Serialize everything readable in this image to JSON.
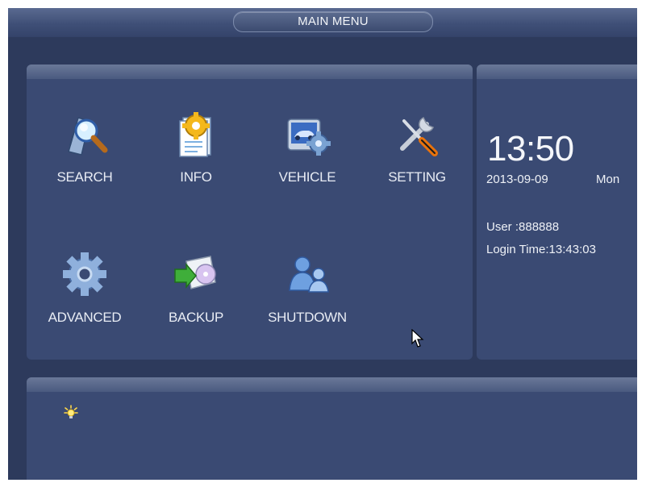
{
  "window": {
    "title": "MAIN MENU"
  },
  "menu": {
    "items": [
      {
        "label": "SEARCH",
        "icon": "search-icon"
      },
      {
        "label": "INFO",
        "icon": "info-icon"
      },
      {
        "label": "VEHICLE",
        "icon": "vehicle-icon"
      },
      {
        "label": "SETTING",
        "icon": "setting-icon"
      },
      {
        "label": "ADVANCED",
        "icon": "advanced-icon"
      },
      {
        "label": "BACKUP",
        "icon": "backup-icon"
      },
      {
        "label": "SHUTDOWN",
        "icon": "shutdown-icon"
      }
    ]
  },
  "status": {
    "time": "13:50",
    "date": "2013-09-09",
    "day": "Mon",
    "user": "User :888888",
    "login_time": "Login Time:13:43:03"
  },
  "tip": {
    "icon": "light-bulb-icon"
  },
  "colors": {
    "background": "#2d3a5c",
    "panel": "#3a4a73",
    "text": "#eef1f6"
  }
}
